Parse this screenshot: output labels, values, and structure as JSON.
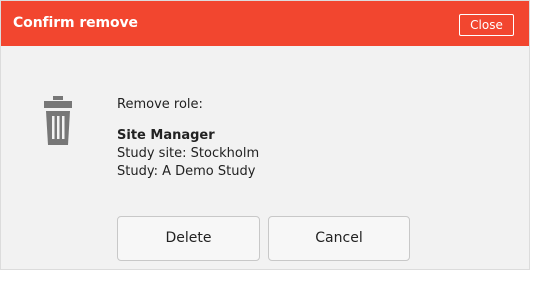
{
  "dialog": {
    "title": "Confirm remove",
    "close_label": "Close",
    "prompt": "Remove role:",
    "role_name": "Site Manager",
    "study_site": "Study site: Stockholm",
    "study": "Study: A Demo Study",
    "delete_label": "Delete",
    "cancel_label": "Cancel",
    "icon": "trash-icon"
  },
  "colors": {
    "header": "#f2462f",
    "body": "#f2f2f2",
    "icon": "#777777"
  }
}
